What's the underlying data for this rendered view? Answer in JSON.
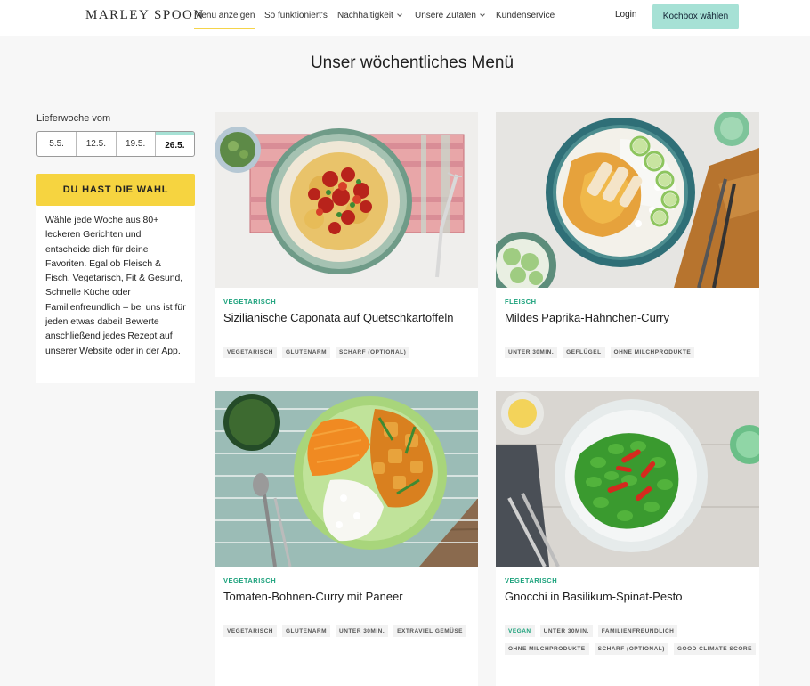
{
  "nav": {
    "logo": "MARLEY SPOON",
    "items": [
      {
        "label": "Menü anzeigen"
      },
      {
        "label": "So funktioniert's"
      },
      {
        "label": "Nachhaltigkeit"
      },
      {
        "label": "Unsere Zutaten"
      },
      {
        "label": "Kundenservice"
      }
    ],
    "login": "Login",
    "cta": "Kochbox wählen"
  },
  "page_title": "Unser wöchentliches Menü",
  "sidebar": {
    "week_label": "Lieferwoche vom",
    "weeks": [
      "5.5.",
      "12.5.",
      "19.5.",
      "26.5."
    ],
    "selected_week": "26.5.",
    "choice_button": "DU HAST DIE WAHL",
    "description": "Wähle jede Woche aus 80+ leckeren Gerichten und entscheide dich für deine Favoriten. Egal ob Fleisch & Fisch, Vegetarisch, Fit & Gesund, Schnelle Küche oder Familienfreundlich – bei uns ist für jeden etwas dabei! Bewerte anschließend jedes Rezept auf unserer Website oder in der App."
  },
  "recipes": [
    {
      "category": "VEGETARISCH",
      "title": "Sizilianische Caponata auf Quetschkartoffeln",
      "tags": [
        "VEGETARISCH",
        "GLUTENARM",
        "SCHARF (OPTIONAL)"
      ]
    },
    {
      "category": "FLEISCH",
      "title": "Mildes Paprika-Hähnchen-Curry",
      "tags": [
        "UNTER 30MIN.",
        "GEFLÜGEL",
        "OHNE MILCHPRODUKTE"
      ]
    },
    {
      "category": "VEGETARISCH",
      "title": "Tomaten-Bohnen-Curry mit Paneer",
      "tags": [
        "VEGETARISCH",
        "GLUTENARM",
        "UNTER 30MIN.",
        "EXTRAVIEL GEMÜSE"
      ]
    },
    {
      "category": "VEGETARISCH",
      "title": "Gnocchi in Basilikum-Spinat-Pesto",
      "tags": [
        "VEGAN",
        "UNTER 30MIN.",
        "FAMILIENFREUNDLICH",
        "OHNE MILCHPRODUKTE",
        "SCHARF (OPTIONAL)",
        "GOOD CLIMATE SCORE"
      ]
    }
  ],
  "colors": {
    "accent_yellow": "#f6d440",
    "accent_mint": "#a6e1d5",
    "category_green": "#1aa17b"
  }
}
